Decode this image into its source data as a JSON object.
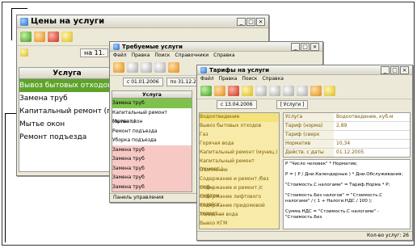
{
  "win1": {
    "title": "Цены на услуги",
    "filter_text": "на 11.",
    "column_header": "Услуга",
    "rows": [
      "Вывоз бытовых отходов",
      "Замена труб",
      "Капитальный ремонт (п",
      "Мытье окон",
      "Ремонт подъезда"
    ]
  },
  "win2": {
    "title": "Требуемые услуги",
    "menu": [
      "Файл",
      "Правка",
      "Поиск",
      "Справочники",
      "Справка"
    ],
    "date_from": "с 01.01.2006",
    "date_to": "по 31.12.20",
    "column_header": "Услуга",
    "rows": [
      "Замена труб",
      "Капитальный ремонт (приват.)",
      "Мытье окон",
      "Ремонт подъезда",
      "Уборка подъезда",
      "Замена труб",
      "Замена труб",
      "Замена труб",
      "Замена труб",
      "Замена труб"
    ],
    "status": "Панель управления"
  },
  "win3": {
    "title": "Тарифы на услуги",
    "menu": [
      "Файл",
      "Правка",
      "Поиск",
      "Справка"
    ],
    "date": "с 13.04.2006",
    "mode": "[ Услуги ]",
    "rows": [
      "Водоотведение",
      "Вывоз бытовых отходов",
      "Газ",
      "Горячая вода",
      "Капитальный ремонт (муниц.)",
      "Капитальный ремонт (приват.)",
      "Отопление",
      "Содержание и ремонт /без лиф...",
      "Содержание и ремонт /с лифтом",
      "Содержание лифтового хозяйст...",
      "Содержание придомовой террит...",
      "Холодная вода",
      "Вывоз КГМ"
    ],
    "props": [
      {
        "k": "Услуга",
        "v": "Водоотведение, куб.м"
      },
      {
        "k": "Тариф (норма)",
        "v": "2,89"
      },
      {
        "k": "Тариф (сверх нормы)",
        "v": ""
      },
      {
        "k": "Норматив",
        "v": "10,34"
      },
      {
        "k": "Действ. с даты",
        "v": "01.12.2005"
      }
    ],
    "formulas": [
      "Р \"Число человек\" * Норматив;",
      "Р = ( Р / Дни.Календарные ) * Дни.Обслуживания;",
      "\"Стоимость.С налогами\" = Тариф.Норма * Р;",
      "\"Стоимость.Без налогов\" = \"Стоимость.С налогами\" / ( 1 + Налоги.НДС / 100 );",
      "Сумма.НДС = \"Стоимость.С налогами\" - \"Стоимость.Без"
    ],
    "status": "Кол-во услуг: 26"
  }
}
